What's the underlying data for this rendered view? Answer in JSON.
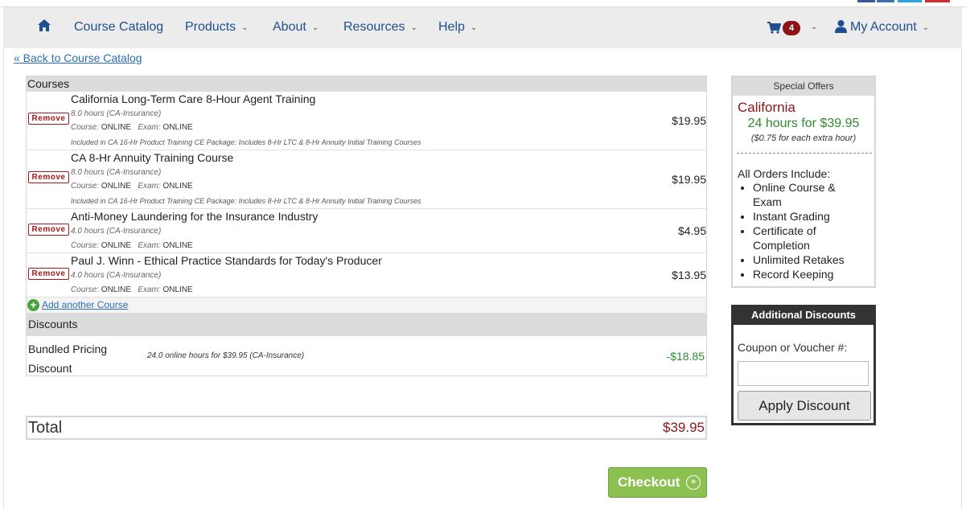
{
  "nav": {
    "home_icon": "home-icon",
    "items": [
      {
        "label": "Course Catalog",
        "has_caret": false
      },
      {
        "label": "Products",
        "has_caret": true
      },
      {
        "label": "About",
        "has_caret": true
      },
      {
        "label": "Resources",
        "has_caret": true
      },
      {
        "label": "Help",
        "has_caret": true
      }
    ],
    "cart_count": "4",
    "account_label": "My Account",
    "caret": "⌄"
  },
  "back_link": "« Back to Course Catalog",
  "courses": {
    "header": "Courses",
    "remove_label": "Remove",
    "course_label": "Course:",
    "exam_label": "Exam:",
    "rows": [
      {
        "title": "California Long-Term Care 8-Hour Agent Training",
        "hours": "8.0 hours  (CA-Insurance)",
        "course_mode": "ONLINE",
        "exam_mode": "ONLINE",
        "package": "Included in CA 16-Hr Product Training CE Package: Includes 8-Hr LTC & 8-Hr Annuity Initial Training Courses",
        "price": "$19.95"
      },
      {
        "title": "CA 8-Hr Annuity Training Course",
        "hours": "8.0 hours  (CA-Insurance)",
        "course_mode": "ONLINE",
        "exam_mode": "ONLINE",
        "package": "Included in CA 16-Hr Product Training CE Package: Includes 8-Hr LTC & 8-Hr Annuity Initial Training Courses",
        "price": "$19.95"
      },
      {
        "title": "Anti-Money Laundering for the Insurance Industry",
        "hours": "4.0 hours  (CA-Insurance)",
        "course_mode": "ONLINE",
        "exam_mode": "ONLINE",
        "price": "$4.95"
      },
      {
        "title": "Paul J. Winn - Ethical Practice Standards for Today's Producer",
        "hours": "4.0 hours  (CA-Insurance)",
        "course_mode": "ONLINE",
        "exam_mode": "ONLINE",
        "price": "$13.95"
      }
    ],
    "add_another": "Add another Course"
  },
  "discounts": {
    "header": "Discounts",
    "name": "Bundled Pricing Discount",
    "description": "24.0 online hours for $39.95 (CA-Insurance)",
    "amount": "-$18.85"
  },
  "total": {
    "label": "Total",
    "amount": "$39.95"
  },
  "checkout_label": "Checkout",
  "special_offers": {
    "header": "Special Offers",
    "state": "California",
    "deal": "24 hours for $39.95",
    "extra": "($0.75 for each extra hour)",
    "includes_title": "All Orders Include:",
    "includes": [
      "Online Course & Exam",
      "Instant Grading",
      "Certificate of Completion",
      "Unlimited Retakes",
      "Record Keeping"
    ]
  },
  "additional_discounts": {
    "header": "Additional Discounts",
    "coupon_label": "Coupon or Voucher #:",
    "coupon_value": "",
    "apply_label": "Apply Discount"
  },
  "colors": {
    "nav_link": "#1f4f8f",
    "price_red": "#8b1414",
    "discount_green": "#2e8b2e",
    "checkout_green": "#8cc152"
  }
}
